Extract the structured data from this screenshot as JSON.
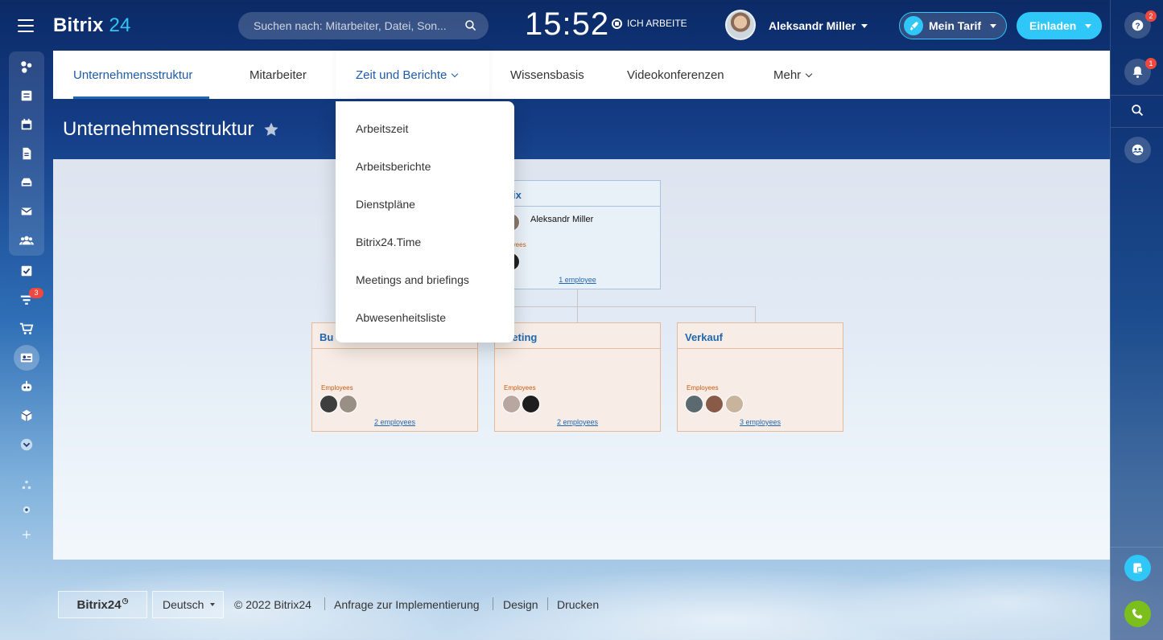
{
  "header": {
    "logo_text": "Bitrix",
    "logo_num": "24",
    "search_placeholder": "Suchen nach: Mitarbeiter, Datei, Son...",
    "clock": "15:52",
    "work_status": "ICH ARBEITE",
    "user_name": "Aleksandr Miller",
    "tarif_label": "Mein Tarif",
    "invite_label": "Einladen"
  },
  "tabs": [
    {
      "label": "Unternehmensstruktur",
      "active": true
    },
    {
      "label": "Mitarbeiter"
    },
    {
      "label": "Zeit und Berichte",
      "open": true
    },
    {
      "label": "Wissensbasis"
    },
    {
      "label": "Videokonferenzen"
    },
    {
      "label": "Mehr"
    }
  ],
  "page_title": "Unternehmensstruktur",
  "dropdown": [
    "Arbeitszeit",
    "Arbeitsberichte",
    "Dienstpläne",
    "Bitrix24.Time",
    "Meetings and briefings",
    "Abwesenheitsliste"
  ],
  "org": {
    "root": {
      "name": "Bitrix",
      "visible_name": "itrix",
      "head": "Aleksandr Miller",
      "employees_label": "ployees",
      "link": "1 employee"
    },
    "departments": [
      {
        "name": "Bu",
        "employees_label": "Employees",
        "link": "2 employees"
      },
      {
        "name": "rketing",
        "employees_label": "Employees",
        "link": "2 employees"
      },
      {
        "name": "Verkauf",
        "employees_label": "Employees",
        "link": "3 employees"
      }
    ]
  },
  "left_sidebar": {
    "badge_count": "3",
    "icons": [
      "burger-menu-icon",
      "feed-icon",
      "tasks-list-icon",
      "calendar-icon",
      "documents-icon",
      "drive-icon",
      "mail-icon",
      "groups-icon",
      "checklist-icon",
      "crm-funnel-icon",
      "shop-cart-icon",
      "company-card-icon",
      "robot-icon",
      "box-icon",
      "more-down-icon",
      "sitemap-icon",
      "settings-icon",
      "add-icon"
    ]
  },
  "right_sidebar": {
    "help_badge": "2",
    "notifications_badge": "1"
  },
  "footer": {
    "logo": "Bitrix24",
    "language": "Deutsch",
    "copyright": "© 2022 Bitrix24",
    "links": [
      "Anfrage zur Implementierung",
      "Design",
      "Drucken"
    ]
  },
  "colors": {
    "accent": "#2fc7f7",
    "active_tab": "#2067b0",
    "badge": "#f0483e",
    "call_button": "#7bbf1d"
  }
}
